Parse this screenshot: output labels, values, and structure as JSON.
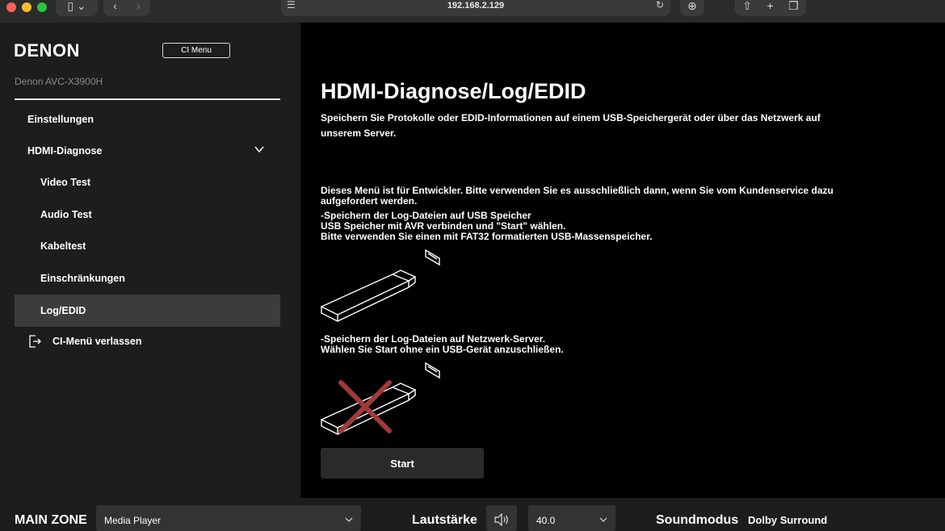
{
  "browser": {
    "url": "192.168.2.129"
  },
  "sidebar": {
    "logo": "DENON",
    "ci_menu_button": "CI Menu",
    "device_name": "Denon AVC-X3900H",
    "items": [
      {
        "label": "Einstellungen"
      },
      {
        "label": "HDMI-Diagnose"
      },
      {
        "label": "Video Test"
      },
      {
        "label": "Audio Test"
      },
      {
        "label": "Kabeltest"
      },
      {
        "label": "Einschränkungen"
      },
      {
        "label": "Log/EDID"
      }
    ],
    "exit_label": "CI-Menü verlassen"
  },
  "main": {
    "title": "HDMI-Diagnose/Log/EDID",
    "intro": "Speichern Sie Protokolle oder EDID-Informationen auf einem USB-Speichergerät oder über das Netzwerk auf unserem Server.",
    "notice": "Dieses Menü ist für Entwickler. Bitte verwenden Sie es ausschließlich dann, wenn Sie vom Kundenservice dazu aufgefordert werden.",
    "usb_heading": "-Speichern der Log-Dateien auf USB Speicher",
    "usb_line1": "USB Speicher mit AVR verbinden und \"Start\" wählen.",
    "usb_line2": "Bitte verwenden Sie einen mit FAT32 formatierten USB-Massenspeicher.",
    "net_heading": "-Speichern der Log-Dateien auf Netzwerk-Server.",
    "net_line1": "Wählen Sie Start ohne ein USB-Gerät anzuschließen.",
    "start_button": "Start"
  },
  "bottombar": {
    "zone_label": "MAIN ZONE",
    "source_value": "Media Player",
    "volume_label": "Lautstärke",
    "volume_value": "40.0",
    "soundmode_label": "Soundmodus",
    "soundmode_value": "Dolby Surround"
  },
  "colors": {
    "sidebar_bg": "#1d1d1d",
    "main_bg": "#000000",
    "active_item_bg": "#3c3c3c",
    "cross_red": "#a33a3a"
  },
  "icons": [
    "sidebar-icon",
    "chevron-left-icon",
    "chevron-right-icon",
    "reload-icon",
    "download-icon",
    "share-icon",
    "plus-icon",
    "tabs-icon",
    "chevron-down-icon",
    "exit-icon",
    "speaker-icon"
  ]
}
